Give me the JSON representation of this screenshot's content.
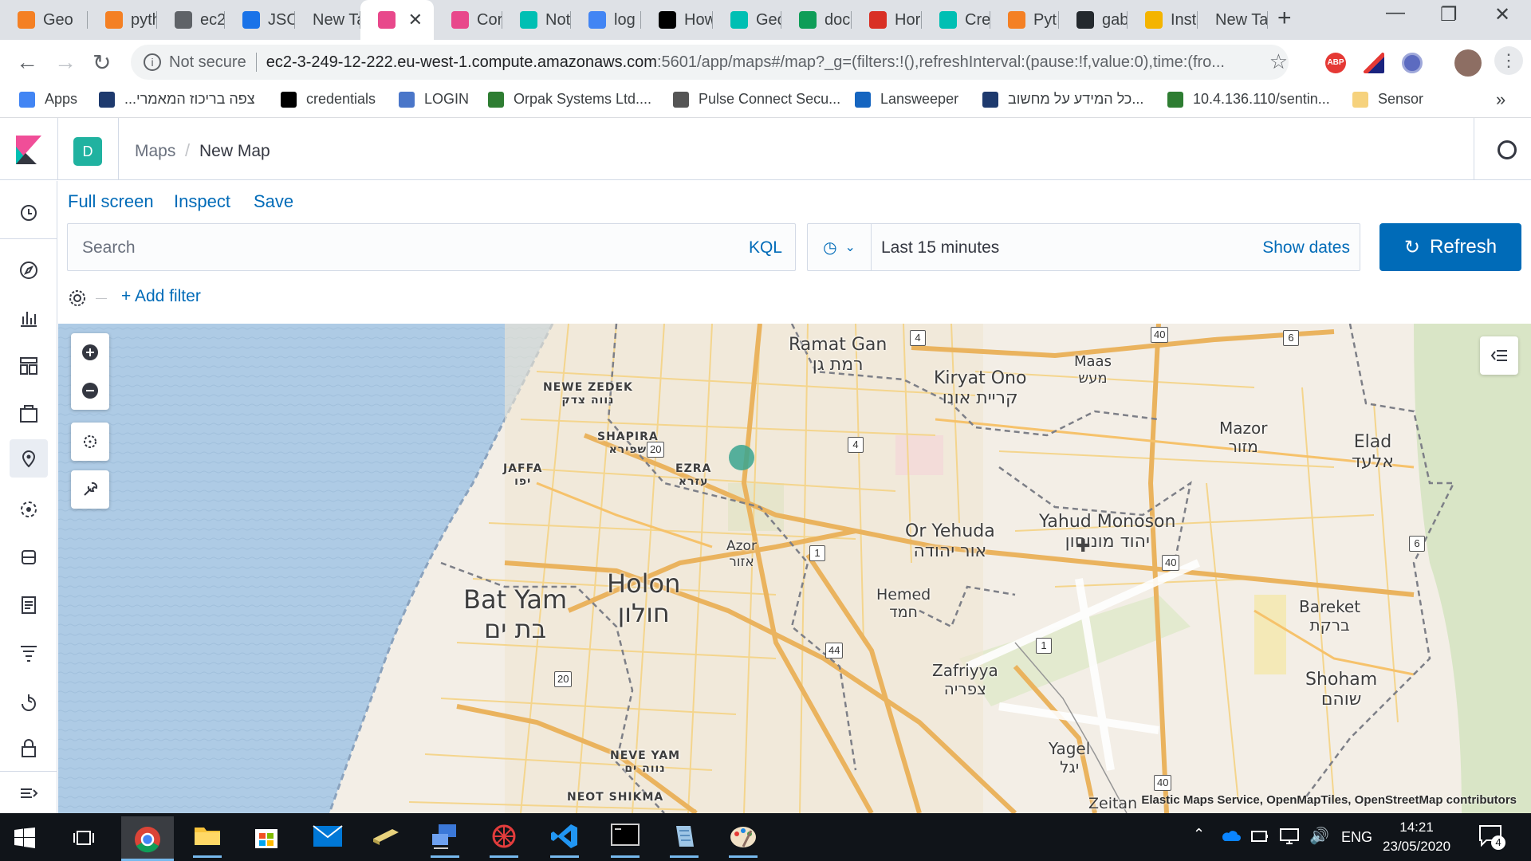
{
  "browser": {
    "tabs": [
      {
        "label": "Geo",
        "icon": "stackoverflow-icon",
        "color": "#f48024"
      },
      {
        "label": "pyth",
        "icon": "stackoverflow-icon",
        "color": "#f48024"
      },
      {
        "label": "ec2",
        "icon": "globe-icon",
        "color": "#5f6368"
      },
      {
        "label": "JSO",
        "icon": "check-icon",
        "color": "#1a73e8"
      },
      {
        "label": "New Tab",
        "icon": "",
        "color": ""
      },
      {
        "label": "",
        "icon": "kibana-icon",
        "color": "#e8488b",
        "active": true
      },
      {
        "label": "Cor",
        "icon": "kibana-icon",
        "color": "#e8488b"
      },
      {
        "label": "Not",
        "icon": "elastic-icon",
        "color": "#00bfb3"
      },
      {
        "label": "log",
        "icon": "google-icon",
        "color": "#4285f4"
      },
      {
        "label": "How",
        "icon": "medium-icon",
        "color": "#000000"
      },
      {
        "label": "Geo",
        "icon": "elastic-icon",
        "color": "#00bfb3"
      },
      {
        "label": "doc",
        "icon": "circle-icon",
        "color": "#0f9d58"
      },
      {
        "label": "Hor",
        "icon": "gmail-icon",
        "color": "#d93025"
      },
      {
        "label": "Cre",
        "icon": "elastic-icon",
        "color": "#00bfb3"
      },
      {
        "label": "Pyt",
        "icon": "stackoverflow-icon",
        "color": "#f48024"
      },
      {
        "label": "gab",
        "icon": "github-icon",
        "color": "#24292e"
      },
      {
        "label": "Inst",
        "icon": "box-icon",
        "color": "#f4b400"
      },
      {
        "label": "New Tab",
        "icon": "",
        "color": ""
      }
    ],
    "security_label": "Not secure",
    "url_host": "ec2-3-249-12-222.eu-west-1.compute.amazonaws.com",
    "url_rest": ":5601/app/maps#/map?_g=(filters:!(),refreshInterval:(pause:!f,value:0),time:(fro...",
    "bookmarks": [
      {
        "label": "Apps"
      },
      {
        "label": "...צפה בריכוז המאמרי"
      },
      {
        "label": "credentials"
      },
      {
        "label": "LOGIN"
      },
      {
        "label": "Orpak Systems Ltd...."
      },
      {
        "label": "Pulse Connect Secu..."
      },
      {
        "label": "Lansweeper"
      },
      {
        "label": "כל המידע על מחשוב..."
      },
      {
        "label": "10.4.136.110/sentin..."
      },
      {
        "label": "Sensor"
      }
    ],
    "bookmarks_more": "»"
  },
  "kibana": {
    "space_initial": "D",
    "breadcrumbs": [
      "Maps",
      "New Map"
    ],
    "breadcrumb_sep": "/",
    "top_menu": [
      "Full screen",
      "Inspect",
      "Save"
    ],
    "search_placeholder": "Search",
    "kql_label": "KQL",
    "time_range": "Last 15 minutes",
    "show_dates": "Show dates",
    "refresh_label": "Refresh",
    "add_filter": "+ Add filter",
    "accent": "#006bb8"
  },
  "map": {
    "labels": [
      {
        "name": "ramat-gan",
        "text": "Ramat Gan\nרמת גן"
      },
      {
        "name": "kiryat-ono",
        "text": "Kiryat Ono\nקריית אונו"
      },
      {
        "name": "maas",
        "text": "Maas\nמעש"
      },
      {
        "name": "mazor",
        "text": "Mazor\nמזור"
      },
      {
        "name": "elad",
        "text": "Elad\nאלעד"
      },
      {
        "name": "newe-zedek",
        "text": "NEWE ZEDEK\nנווה צדק"
      },
      {
        "name": "shapira",
        "text": "SHAPIRA\nשפירא"
      },
      {
        "name": "jaffa",
        "text": "JAFFA\nיפו"
      },
      {
        "name": "ezra",
        "text": "EZRA\nעזרא"
      },
      {
        "name": "azor",
        "text": "Azor\nאזור"
      },
      {
        "name": "or-yehuda",
        "text": "Or Yehuda\nאור יהודה"
      },
      {
        "name": "yahud-monoson",
        "text": "Yahud Monoson\nיהוד מונוסון"
      },
      {
        "name": "hemed",
        "text": "Hemed\nחמד"
      },
      {
        "name": "bat-yam",
        "text": "Bat Yam\nבת ים"
      },
      {
        "name": "holon",
        "text": "Holon\nחולון"
      },
      {
        "name": "bareket",
        "text": "Bareket\nברקת"
      },
      {
        "name": "shoham",
        "text": "Shoham\nשוהם"
      },
      {
        "name": "zafriyya",
        "text": "Zafriyya\nצפריה"
      },
      {
        "name": "neve-yam",
        "text": "NEVE YAM\nנווה ים"
      },
      {
        "name": "yagel",
        "text": "Yagel\nיגל"
      },
      {
        "name": "neot-shikma",
        "text": "NEOT SHIKMA"
      },
      {
        "name": "zeitan",
        "text": "Zeitan"
      }
    ],
    "road_shields": [
      "4",
      "40",
      "6",
      "20",
      "4",
      "1",
      "40",
      "6",
      "20",
      "44",
      "1",
      "40"
    ],
    "attribution": "Elastic Maps Service, OpenMapTiles, OpenStreetMap contributors",
    "point_color": "#3aa58f"
  },
  "taskbar": {
    "language": "ENG",
    "time": "14:21",
    "date": "23/05/2020",
    "notifications": "4"
  }
}
